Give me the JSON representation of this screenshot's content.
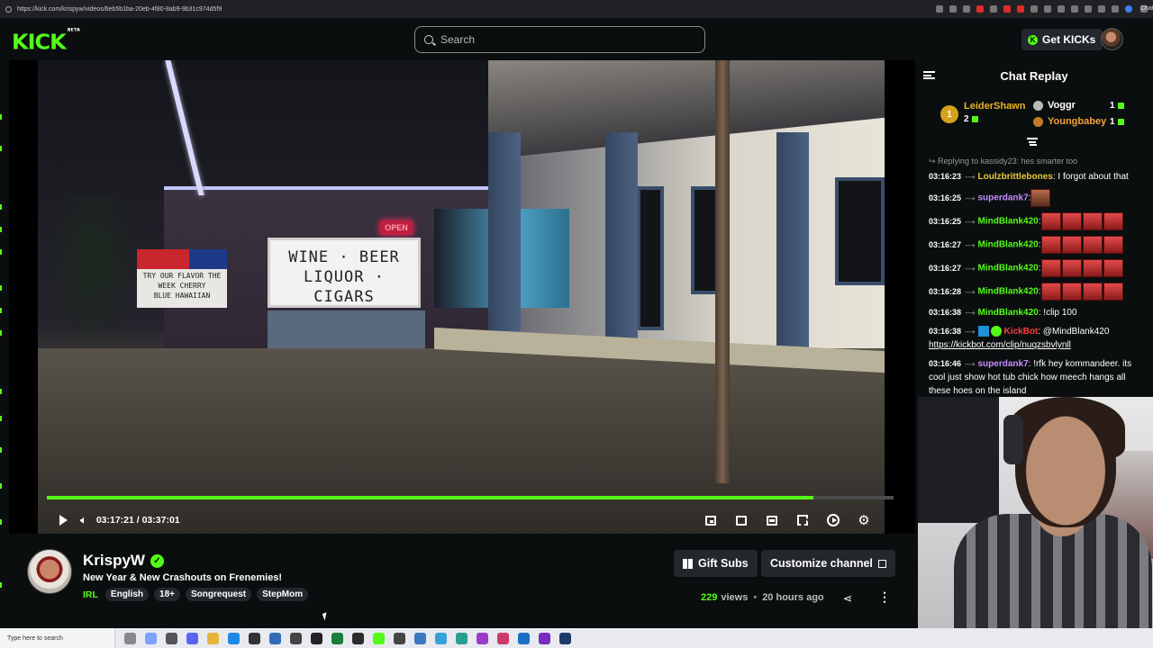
{
  "browser": {
    "url": "https://kick.com/krispyw/videos/6eb5b1ba-20eb-4f80-8ab9-9b31c974d5f9",
    "profile_label": "Chat"
  },
  "header": {
    "logo": "KICK",
    "logo_badge": "BETA",
    "search_placeholder": "Search",
    "get_kicks_label": "Get KICKs"
  },
  "video": {
    "sign_text_line1": "WINE · BEER",
    "sign_text_line2": "LIQUOR · CIGARS",
    "open_sign": "OPEN",
    "small_sign_line1": "TRY OUR FLAVOR THE",
    "small_sign_line2": "WEEK  CHERRY",
    "small_sign_line3": "BLUE HAWAIIAN",
    "progress_fraction": 0.9058,
    "current_time": "03:17:21",
    "duration": "03:37:01",
    "time_display": "03:17:21 / 03:37:01"
  },
  "channel": {
    "name": "KrispyW",
    "stream_title": "New Year & New Crashouts on Frenemies!",
    "category": "IRL",
    "tags": [
      "English",
      "18+",
      "Songrequest",
      "StepMom"
    ],
    "gift_subs_label": "Gift Subs",
    "customize_label": "Customize channel",
    "views_count": "229",
    "views_label": "views",
    "posted_ago": "20 hours ago"
  },
  "chat": {
    "title": "Chat Replay",
    "leaders": [
      {
        "rank": "1",
        "name": "LeiderShawn",
        "count": "2",
        "color": "#e6b422"
      },
      {
        "name": "Voggr",
        "count": "1",
        "color": "#ffffff"
      },
      {
        "name": "Youngbabey",
        "count": "1",
        "color": "#f2a33a"
      }
    ],
    "messages": [
      {
        "reply": "Replying to kassidy23: hes smarter too",
        "ts": "03:16:23",
        "user": "Loulzbrittlebones",
        "color": "#e7c93a",
        "text": ": I forgot about that"
      },
      {
        "ts": "03:16:25",
        "user": "superdank7",
        "color": "#c58cff",
        "text": ":",
        "emotes": 1,
        "small": true
      },
      {
        "ts": "03:16:25",
        "user": "MindBlank420",
        "color": "#53fc18",
        "text": ":",
        "emotes": 4
      },
      {
        "ts": "03:16:27",
        "user": "MindBlank420",
        "color": "#53fc18",
        "text": ":",
        "emotes": 4
      },
      {
        "ts": "03:16:27",
        "user": "MindBlank420",
        "color": "#53fc18",
        "text": ":",
        "emotes": 4
      },
      {
        "ts": "03:16:28",
        "user": "MindBlank420",
        "color": "#53fc18",
        "text": ":",
        "emotes": 4
      },
      {
        "ts": "03:16:38",
        "user": "MindBlank420",
        "color": "#53fc18",
        "text": ": !clip 100"
      },
      {
        "ts": "03:16:38",
        "user": "KickBot",
        "color": "#ff3b3b",
        "bot": true,
        "text": ": @MindBlank420",
        "link": "https://kickbot.com/clip/nuqzsbvlynll"
      },
      {
        "ts": "03:16:46",
        "user": "superdank7",
        "color": "#c58cff",
        "text": ": !rfk hey kommandeer. its cool just show hot tub chick how meech hangs all these hoes on the island"
      }
    ]
  },
  "taskbar": {
    "search_placeholder": "Type here to search"
  },
  "colors": {
    "accent": "#53fc18",
    "background": "#0b0e0f",
    "button_bg": "#24272c"
  }
}
